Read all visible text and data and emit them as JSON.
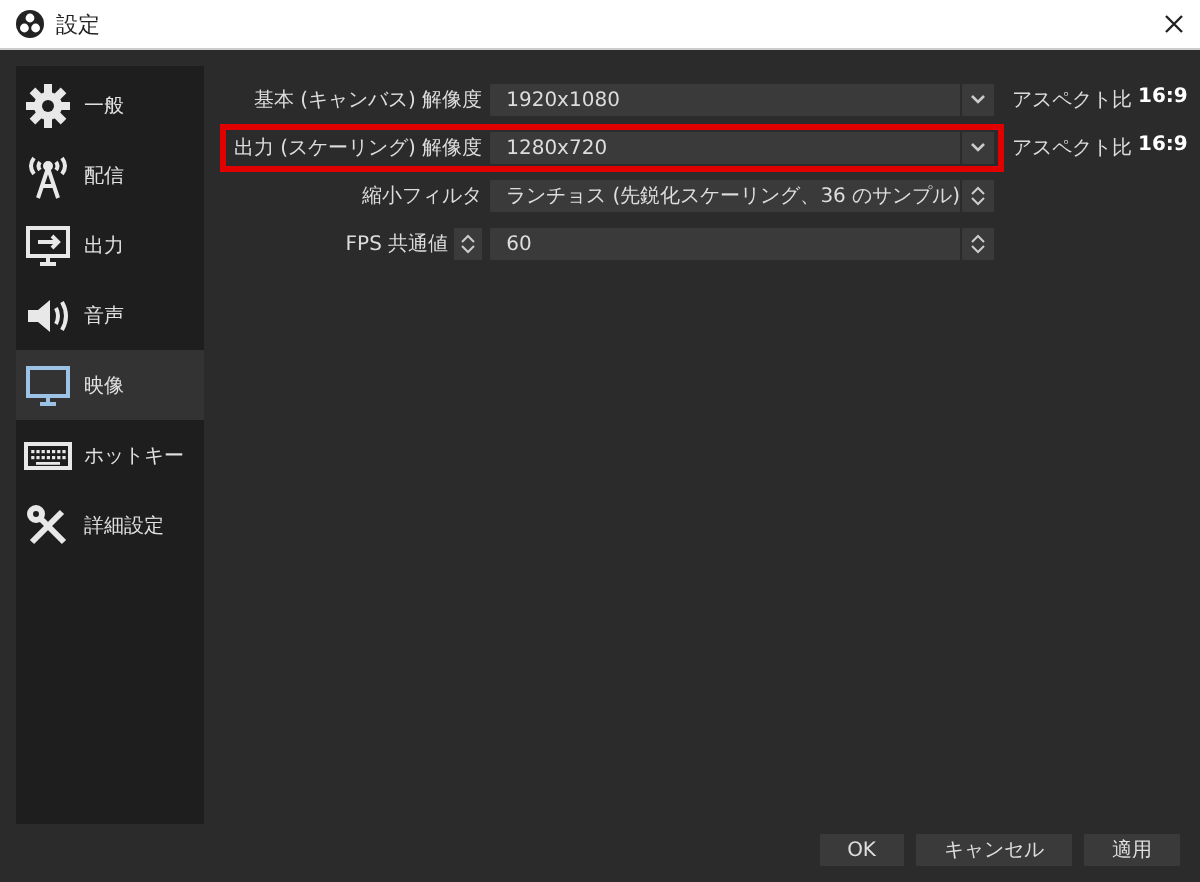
{
  "window": {
    "title": "設定"
  },
  "sidebar": {
    "items": [
      {
        "label": "一般",
        "selected": false
      },
      {
        "label": "配信",
        "selected": false
      },
      {
        "label": "出力",
        "selected": false
      },
      {
        "label": "音声",
        "selected": false
      },
      {
        "label": "映像",
        "selected": true
      },
      {
        "label": "ホットキー",
        "selected": false
      },
      {
        "label": "詳細設定",
        "selected": false
      }
    ]
  },
  "settings": [
    {
      "kind": "dropdown",
      "label": "基本 (キャンバス) 解像度",
      "value": "1920x1080",
      "aspect_label": "アスペクト比",
      "aspect_value": "16:9",
      "highlighted": false
    },
    {
      "kind": "dropdown",
      "label": "出力 (スケーリング) 解像度",
      "value": "1280x720",
      "aspect_label": "アスペクト比",
      "aspect_value": "16:9",
      "highlighted": true
    },
    {
      "kind": "select",
      "label": "縮小フィルタ",
      "value": "ランチョス (先鋭化スケーリング、36 のサンプル)",
      "highlighted": false
    },
    {
      "kind": "spin_select",
      "label": "FPS 共通値",
      "value": "60",
      "highlighted": false
    }
  ],
  "buttons": [
    "OK",
    "キャンセル",
    "適用"
  ]
}
